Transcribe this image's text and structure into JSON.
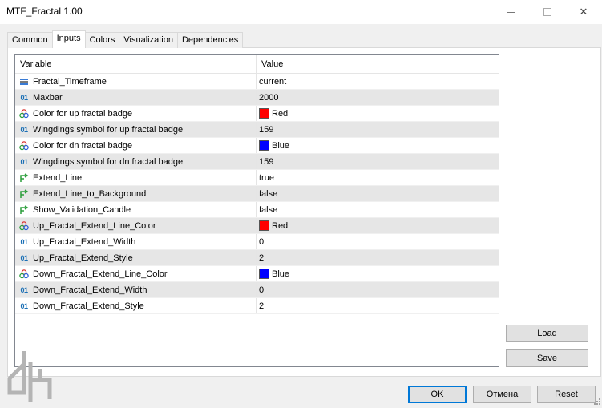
{
  "window": {
    "title": "MTF_Fractal 1.00",
    "minimize_icon": "minimize-icon",
    "maximize_icon": "maximize-icon",
    "close_glyph": "✕"
  },
  "tabs": [
    {
      "label": "Common",
      "active": false
    },
    {
      "label": "Inputs",
      "active": true
    },
    {
      "label": "Colors",
      "active": false
    },
    {
      "label": "Visualization",
      "active": false
    },
    {
      "label": "Dependencies",
      "active": false
    }
  ],
  "table": {
    "columns": [
      "Variable",
      "Value"
    ],
    "rows": [
      {
        "icon": "enum-icon",
        "variable": "Fractal_Timeframe",
        "value": "current"
      },
      {
        "icon": "int-icon",
        "variable": "Maxbar",
        "value": "2000"
      },
      {
        "icon": "color-icon",
        "variable": "Color for up fractal badge",
        "value": "Red",
        "swatch": "#ff0000"
      },
      {
        "icon": "int-icon",
        "variable": "Wingdings symbol for up fractal badge",
        "value": "159"
      },
      {
        "icon": "color-icon",
        "variable": "Color for dn fractal badge",
        "value": "Blue",
        "swatch": "#0000ff"
      },
      {
        "icon": "int-icon",
        "variable": "Wingdings symbol for dn fractal badge",
        "value": "159"
      },
      {
        "icon": "bool-icon",
        "variable": "Extend_Line",
        "value": "true"
      },
      {
        "icon": "bool-icon",
        "variable": "Extend_Line_to_Background",
        "value": "false"
      },
      {
        "icon": "bool-icon",
        "variable": "Show_Validation_Candle",
        "value": "false"
      },
      {
        "icon": "color-icon",
        "variable": "Up_Fractal_Extend_Line_Color",
        "value": "Red",
        "swatch": "#ff0000"
      },
      {
        "icon": "int-icon",
        "variable": "Up_Fractal_Extend_Width",
        "value": "0"
      },
      {
        "icon": "int-icon",
        "variable": "Up_Fractal_Extend_Style",
        "value": "2"
      },
      {
        "icon": "color-icon",
        "variable": "Down_Fractal_Extend_Line_Color",
        "value": "Blue",
        "swatch": "#0000ff"
      },
      {
        "icon": "int-icon",
        "variable": "Down_Fractal_Extend_Width",
        "value": "0"
      },
      {
        "icon": "int-icon",
        "variable": "Down_Fractal_Extend_Style",
        "value": "2"
      }
    ]
  },
  "buttons": {
    "load": "Load",
    "save": "Save",
    "ok": "OK",
    "cancel": "Отмена",
    "reset": "Reset"
  },
  "colors": {
    "accent": "#0078d7",
    "red": "#ff0000",
    "blue": "#0000ff"
  }
}
